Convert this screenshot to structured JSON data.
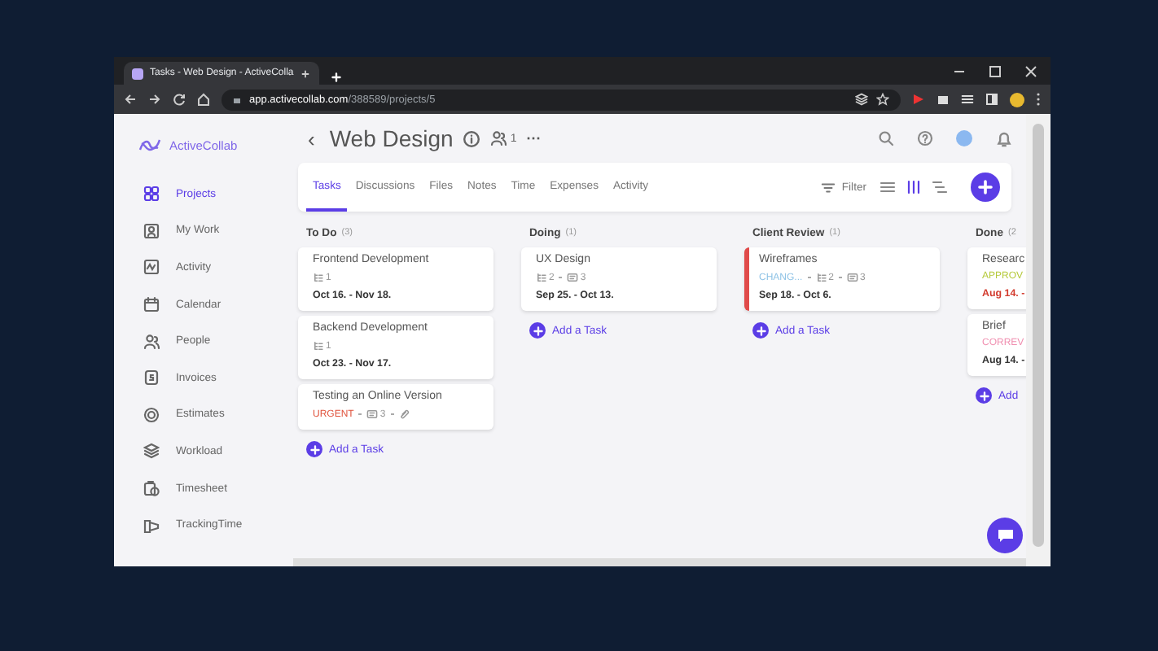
{
  "browser": {
    "tab_title": "Tasks - Web Design - ActiveColla",
    "url_host": "app.activecollab.com",
    "url_path": "/388589/projects/5"
  },
  "sidebar": {
    "brand": "ActiveCollab",
    "items": [
      {
        "label": "Projects",
        "kind": "grid",
        "selected": true
      },
      {
        "label": "My Work",
        "kind": "person",
        "selected": false
      },
      {
        "label": "Activity",
        "kind": "pulse",
        "selected": false
      },
      {
        "label": "Calendar",
        "kind": "calendar",
        "selected": false
      },
      {
        "label": "People",
        "kind": "people",
        "selected": false
      },
      {
        "label": "Invoices",
        "kind": "invoice",
        "selected": false
      },
      {
        "label": "Estimates",
        "kind": "target",
        "selected": false
      },
      {
        "label": "Workload",
        "kind": "layers",
        "selected": false
      },
      {
        "label": "Timesheet",
        "kind": "clock",
        "selected": false
      },
      {
        "label": "TrackingTime",
        "kind": "tracking",
        "selected": false
      }
    ]
  },
  "header": {
    "back": "‹",
    "title": "Web Design",
    "members": "1",
    "more": "···"
  },
  "toolbar": {
    "tabs": [
      {
        "label": "Tasks",
        "selected": true
      },
      {
        "label": "Discussions",
        "selected": false
      },
      {
        "label": "Files",
        "selected": false
      },
      {
        "label": "Notes",
        "selected": false
      },
      {
        "label": "Time",
        "selected": false
      },
      {
        "label": "Expenses",
        "selected": false
      },
      {
        "label": "Activity",
        "selected": false
      }
    ],
    "filter": "Filter",
    "views": [
      {
        "kind": "list",
        "selected": false
      },
      {
        "kind": "columns",
        "selected": true
      },
      {
        "kind": "timeline",
        "selected": false
      }
    ]
  },
  "board": {
    "columns": [
      {
        "title": "To Do",
        "count": "(3)",
        "add": "Add a Task",
        "cards": [
          {
            "title": "Frontend Development",
            "flagged": false,
            "meta": [
              {
                "kind": "subtasks",
                "text": "1"
              }
            ],
            "dates": "Oct 16. - Nov 18.",
            "overdue": false
          },
          {
            "title": "Backend Development",
            "flagged": false,
            "meta": [
              {
                "kind": "subtasks",
                "text": "1"
              }
            ],
            "dates": "Oct 23. - Nov 17.",
            "overdue": false
          },
          {
            "title": "Testing an Online Version",
            "flagged": false,
            "tag": {
              "text": "URGENT",
              "color": "#e0533d"
            },
            "meta": [
              {
                "kind": "comments",
                "text": "3"
              },
              {
                "kind": "attachment"
              }
            ]
          }
        ]
      },
      {
        "title": "Doing",
        "count": "(1)",
        "add": "Add a Task",
        "cards": [
          {
            "title": "UX Design",
            "flagged": false,
            "meta": [
              {
                "kind": "subtasks",
                "text": "2"
              },
              {
                "kind": "comments",
                "text": "3"
              }
            ],
            "dates": "Sep 25. - Oct 13.",
            "overdue": false
          }
        ]
      },
      {
        "title": "Client Review",
        "count": "(1)",
        "add": "Add a Task",
        "cards": [
          {
            "title": "Wireframes",
            "flagged": true,
            "tag": {
              "text": "CHANG...",
              "color": "#8fc3e6"
            },
            "meta": [
              {
                "kind": "subtasks",
                "text": "2"
              },
              {
                "kind": "comments",
                "text": "3"
              }
            ],
            "dates": "Sep 18. - Oct 6.",
            "overdue": false
          }
        ]
      },
      {
        "title": "Done",
        "count": "(2",
        "add": "Add",
        "cards": [
          {
            "title": "Researc",
            "flagged": false,
            "tag": {
              "text": "APPROV",
              "color": "#b5c93a"
            },
            "dates": "Aug 14. -",
            "overdue": true
          },
          {
            "title": "Brief",
            "flagged": false,
            "tag": {
              "text": "CORREV",
              "color": "#f08fb0"
            },
            "dates": "Aug 14. -",
            "overdue": false
          }
        ]
      }
    ]
  }
}
